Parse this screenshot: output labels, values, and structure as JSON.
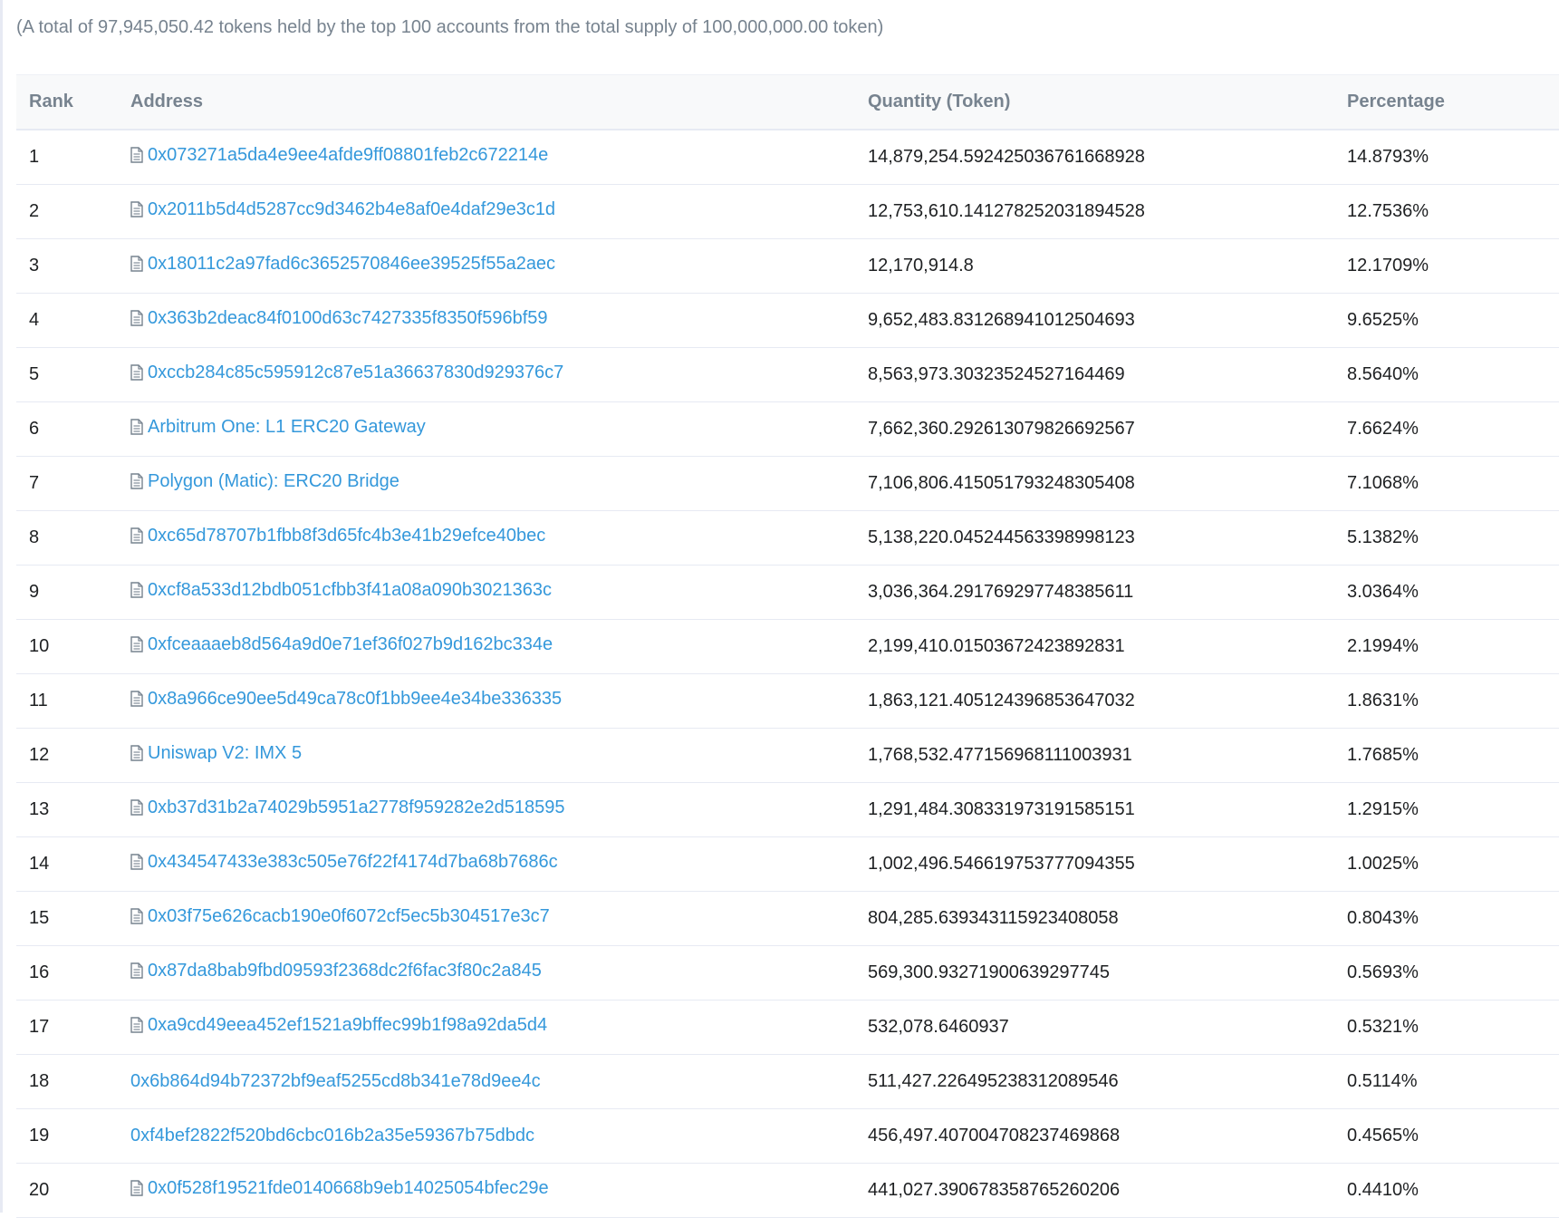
{
  "summary": "(A total of 97,945,050.42 tokens held by the top 100 accounts from the total supply of 100,000,000.00 token)",
  "columns": {
    "rank": "Rank",
    "address": "Address",
    "quantity": "Quantity (Token)",
    "percentage": "Percentage"
  },
  "icons": {
    "contract": "file-text-icon",
    "link_color": "#3498db"
  },
  "rows": [
    {
      "rank": "1",
      "address": "0x073271a5da4e9ee4afde9ff08801feb2c672214e",
      "is_contract": true,
      "quantity": "14,879,254.592425036761668928",
      "percentage": "14.8793%"
    },
    {
      "rank": "2",
      "address": "0x2011b5d4d5287cc9d3462b4e8af0e4daf29e3c1d",
      "is_contract": true,
      "quantity": "12,753,610.141278252031894528",
      "percentage": "12.7536%"
    },
    {
      "rank": "3",
      "address": "0x18011c2a97fad6c3652570846ee39525f55a2aec",
      "is_contract": true,
      "quantity": "12,170,914.8",
      "percentage": "12.1709%"
    },
    {
      "rank": "4",
      "address": "0x363b2deac84f0100d63c7427335f8350f596bf59",
      "is_contract": true,
      "quantity": "9,652,483.831268941012504693",
      "percentage": "9.6525%"
    },
    {
      "rank": "5",
      "address": "0xccb284c85c595912c87e51a36637830d929376c7",
      "is_contract": true,
      "quantity": "8,563,973.30323524527164469",
      "percentage": "8.5640%"
    },
    {
      "rank": "6",
      "address": "Arbitrum One: L1 ERC20 Gateway",
      "is_contract": true,
      "quantity": "7,662,360.292613079826692567",
      "percentage": "7.6624%"
    },
    {
      "rank": "7",
      "address": "Polygon (Matic): ERC20 Bridge",
      "is_contract": true,
      "quantity": "7,106,806.415051793248305408",
      "percentage": "7.1068%"
    },
    {
      "rank": "8",
      "address": "0xc65d78707b1fbb8f3d65fc4b3e41b29efce40bec",
      "is_contract": true,
      "quantity": "5,138,220.045244563398998123",
      "percentage": "5.1382%"
    },
    {
      "rank": "9",
      "address": "0xcf8a533d12bdb051cfbb3f41a08a090b3021363c",
      "is_contract": true,
      "quantity": "3,036,364.291769297748385611",
      "percentage": "3.0364%"
    },
    {
      "rank": "10",
      "address": "0xfceaaaeb8d564a9d0e71ef36f027b9d162bc334e",
      "is_contract": true,
      "quantity": "2,199,410.01503672423892831",
      "percentage": "2.1994%"
    },
    {
      "rank": "11",
      "address": "0x8a966ce90ee5d49ca78c0f1bb9ee4e34be336335",
      "is_contract": true,
      "quantity": "1,863,121.405124396853647032",
      "percentage": "1.8631%"
    },
    {
      "rank": "12",
      "address": "Uniswap V2: IMX 5",
      "is_contract": true,
      "quantity": "1,768,532.477156968111003931",
      "percentage": "1.7685%"
    },
    {
      "rank": "13",
      "address": "0xb37d31b2a74029b5951a2778f959282e2d518595",
      "is_contract": true,
      "quantity": "1,291,484.308331973191585151",
      "percentage": "1.2915%"
    },
    {
      "rank": "14",
      "address": "0x434547433e383c505e76f22f4174d7ba68b7686c",
      "is_contract": true,
      "quantity": "1,002,496.546619753777094355",
      "percentage": "1.0025%"
    },
    {
      "rank": "15",
      "address": "0x03f75e626cacb190e0f6072cf5ec5b304517e3c7",
      "is_contract": true,
      "quantity": "804,285.639343115923408058",
      "percentage": "0.8043%"
    },
    {
      "rank": "16",
      "address": "0x87da8bab9fbd09593f2368dc2f6fac3f80c2a845",
      "is_contract": true,
      "quantity": "569,300.93271900639297745",
      "percentage": "0.5693%"
    },
    {
      "rank": "17",
      "address": "0xa9cd49eea452ef1521a9bffec99b1f98a92da5d4",
      "is_contract": true,
      "quantity": "532,078.6460937",
      "percentage": "0.5321%"
    },
    {
      "rank": "18",
      "address": "0x6b864d94b72372bf9eaf5255cd8b341e78d9ee4c",
      "is_contract": false,
      "quantity": "511,427.226495238312089546",
      "percentage": "0.5114%"
    },
    {
      "rank": "19",
      "address": "0xf4bef2822f520bd6cbc016b2a35e59367b75dbdc",
      "is_contract": false,
      "quantity": "456,497.407004708237469868",
      "percentage": "0.4565%"
    },
    {
      "rank": "20",
      "address": "0x0f528f19521fde0140668b9eb14025054bfec29e",
      "is_contract": true,
      "quantity": "441,027.390678358765260206",
      "percentage": "0.4410%"
    }
  ]
}
